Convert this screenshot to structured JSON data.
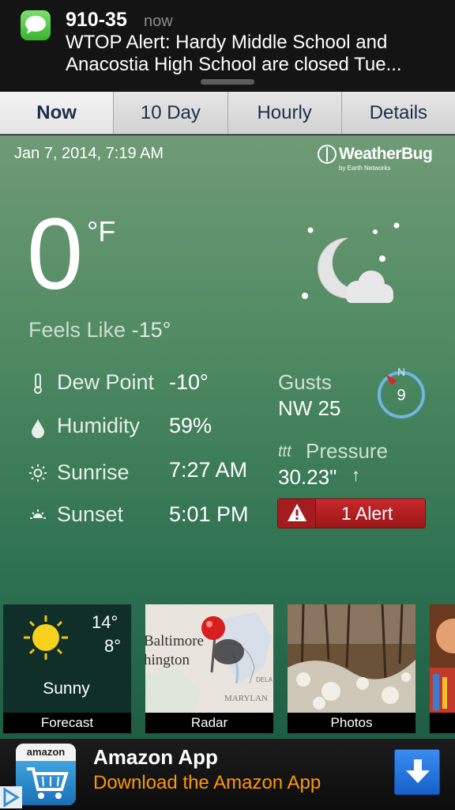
{
  "notification": {
    "sender": "910-35",
    "time": "now",
    "message": "WTOP Alert: Hardy Middle School and Anacostia High School are closed Tue..."
  },
  "tabs": [
    {
      "label": "Now",
      "active": true
    },
    {
      "label": "10 Day",
      "active": false
    },
    {
      "label": "Hourly",
      "active": false
    },
    {
      "label": "Details",
      "active": false
    }
  ],
  "weather": {
    "datetime": "Jan 7, 2014, 7:19 AM",
    "brand": "WeatherBug",
    "brand_sub": "by Earth Networks",
    "temperature": "0",
    "unit": "°F",
    "feels_like_label": "Feels Like",
    "feels_like_value": "-15°",
    "condition_icon": "moon-cloud-icon",
    "dew_point_label": "Dew Point",
    "dew_point_value": "-10°",
    "humidity_label": "Humidity",
    "humidity_value": "59%",
    "sunrise_label": "Sunrise",
    "sunrise_value": "7:27 AM",
    "sunset_label": "Sunset",
    "sunset_value": "5:01 PM",
    "gusts_label": "Gusts",
    "gusts_value": "NW 25",
    "compass_north": "N",
    "compass_speed": "9",
    "pressure_label": "Pressure",
    "pressure_value": "30.23\"",
    "pressure_trend": "↑",
    "alert_label": "1 Alert"
  },
  "tiles": [
    {
      "caption": "Forecast",
      "high": "14°",
      "low": "8°",
      "condition": "Sunny"
    },
    {
      "caption": "Radar",
      "map_labels": [
        "Baltimore",
        "hington",
        "MARYLAN",
        "DELA"
      ]
    },
    {
      "caption": "Photos"
    }
  ],
  "ad": {
    "logo_text": "amazon",
    "title": "Amazon App",
    "subtitle": "Download the Amazon App"
  },
  "colors": {
    "accent_orange": "#ff9900",
    "alert_red": "#c8282c",
    "panel_green": "#4f8a62"
  }
}
